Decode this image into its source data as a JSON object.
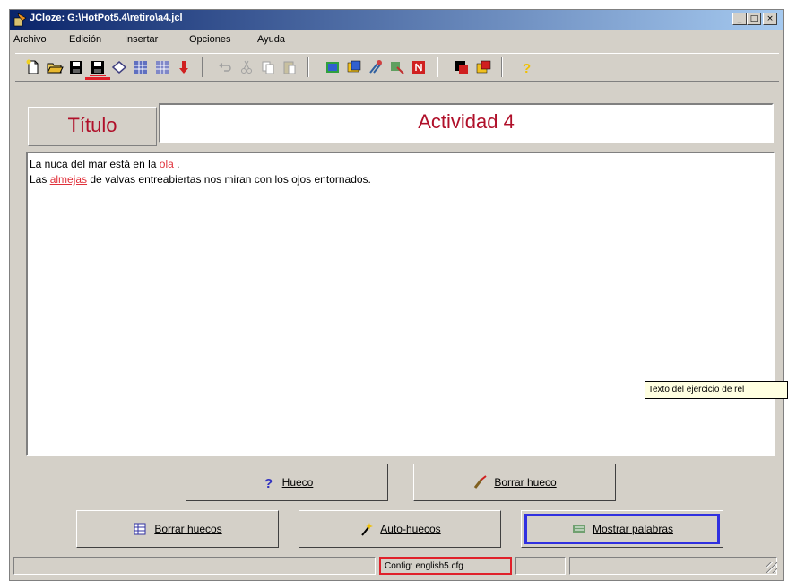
{
  "window": {
    "title": "JCloze: G:\\HotPot5.4\\retiro\\a4.jcl",
    "minimize": "_",
    "maximize": "□",
    "close": "×"
  },
  "menu": [
    "Archivo",
    "Edición",
    "Insertar",
    "Opciones",
    "Ayuda"
  ],
  "toolbar": {
    "buttons": [
      "new-icon",
      "open-icon",
      "save-icon",
      "save-as-icon",
      "erase-icon",
      "grid-icon",
      "grid-alt-icon",
      "arrow-down-icon",
      "undo-icon",
      "cut-icon",
      "copy-icon",
      "paste-icon",
      "html-icon",
      "web-icon",
      "tools-icon",
      "export-icon",
      "flash-icon",
      "config-icon",
      "make-icon",
      "help-icon"
    ],
    "accent": "#e0202a"
  },
  "title": {
    "label": "Título",
    "value": "Actividad 4"
  },
  "exercise": {
    "line1_before": "La nuca del mar está en la ",
    "line1_gap": "ola",
    "line1_after": " .",
    "line2_before": "Las ",
    "line2_gap": "almejas",
    "line2_after": " de valvas entreabiertas nos miran con los ojos entornados."
  },
  "tooltip": "Texto del ejercicio de rel",
  "buttons": {
    "hueco": "Hueco",
    "borrar_hueco": "Borrar hueco",
    "borrar_huecos": "Borrar huecos",
    "auto_huecos": "Auto-huecos",
    "mostrar_palabras": "Mostrar palabras"
  },
  "status": {
    "config": "Config: english5.cfg"
  },
  "colors": {
    "title_text": "#b0102a",
    "gap_text": "#e0303a",
    "highlight": "#e0202a",
    "focus": "#3030e0"
  }
}
